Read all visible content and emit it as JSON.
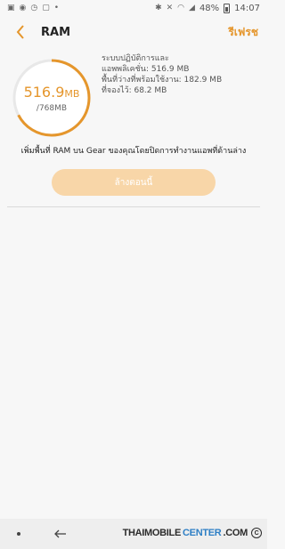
{
  "status_bar": {
    "battery": "48%",
    "time": "14:07"
  },
  "header": {
    "title": "RAM",
    "refresh_label": "รีเฟรช"
  },
  "ram": {
    "used_value": "516.9",
    "used_unit": "MB",
    "total": "/768MB",
    "used_fraction": 0.673
  },
  "details": {
    "line1": "ระบบปฏิบัติการและ",
    "line2": "แอพพลิเคชั่น: 516.9 MB",
    "line3": "พื้นที่ว่างที่พร้อมใช้งาน: 182.9 MB",
    "line4": "ที่จองไว้: 68.2 MB"
  },
  "main": {
    "message": "เพิ่มพื้นที่ RAM บน Gear ของคุณโดยปิดการทำงานแอพที่ด้านล่าง",
    "clean_button": "ล้างตอนนี้"
  },
  "watermark": {
    "part1": "THAIMOBILE",
    "part2": "CENTER",
    "part3": ".COM",
    "mark": "C"
  },
  "colors": {
    "accent": "#e5962c",
    "ring_track": "#e8e8e8",
    "button_bg": "#f8d6a8"
  }
}
